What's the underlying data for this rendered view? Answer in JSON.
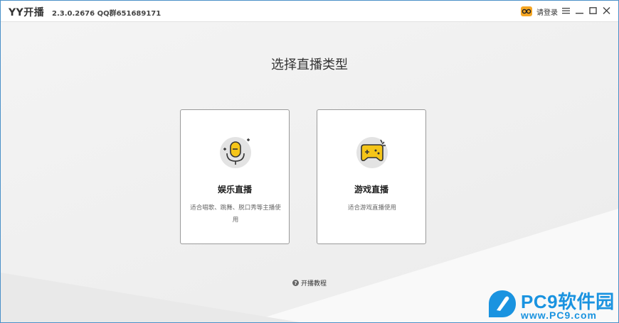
{
  "titlebar": {
    "app_title": "YY开播",
    "version_info": "2.3.0.2676 QQ群651689171",
    "login_label": "请登录",
    "login_icon": "yy-avatar-icon"
  },
  "main": {
    "title": "选择直播类型",
    "cards": [
      {
        "title": "娱乐直播",
        "description": "适合唱歌、跳舞、脱口秀等主播使用",
        "icon": "microphone-icon"
      },
      {
        "title": "游戏直播",
        "description": "适合游戏直播使用",
        "icon": "gamepad-icon"
      }
    ],
    "tutorial_label": "开播教程"
  },
  "watermark": {
    "brand": "PC9软件园",
    "url": "www.PC9.com"
  },
  "colors": {
    "accent_yellow": "#f5c518",
    "watermark_blue": "#1a93e0",
    "window_border": "#4a90c8"
  }
}
